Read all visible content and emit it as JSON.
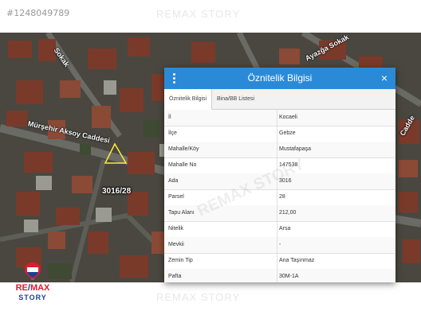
{
  "listing_id": "#1248049789",
  "watermark_text": "REMAX STORY",
  "map": {
    "street_labels": [
      "Mürşehir Aksoy Caddesi",
      "Sokak",
      "Ayazğa Sokak",
      "Cadde"
    ],
    "parcel_label": "3016/28"
  },
  "logo": {
    "brand_red": "RE",
    "brand_slash": "/",
    "brand_max": "MAX",
    "sub": "STORY",
    "colors": {
      "red": "#dc1c2e",
      "blue": "#1c3f94"
    }
  },
  "dialog": {
    "title": "Öznitelik Bilgisi",
    "menu_icon": "vertical-dots-icon",
    "close_glyph": "×",
    "header_color": "#2a8ad8",
    "tabs": [
      "Öznitelik Bilgisi",
      "Bina/BB Listesi"
    ],
    "rows": [
      {
        "key": "İl",
        "value": "Kocaeli"
      },
      {
        "key": "İlçe",
        "value": "Gebze"
      },
      {
        "key": "Mahalle/Köy",
        "value": "Mustafapaşa"
      },
      {
        "key": "Mahalle No",
        "value": "147538"
      },
      {
        "key": "Ada",
        "value": "3016"
      },
      {
        "key": "Parsel",
        "value": "28"
      },
      {
        "key": "Tapu Alanı",
        "value": "212,00"
      },
      {
        "key": "Nitelik",
        "value": "Arsa"
      },
      {
        "key": "Mevkii",
        "value": "-"
      },
      {
        "key": "Zemin Tip",
        "value": "Ana Taşınmaz"
      },
      {
        "key": "Pafta",
        "value": "30M-1A"
      }
    ]
  }
}
